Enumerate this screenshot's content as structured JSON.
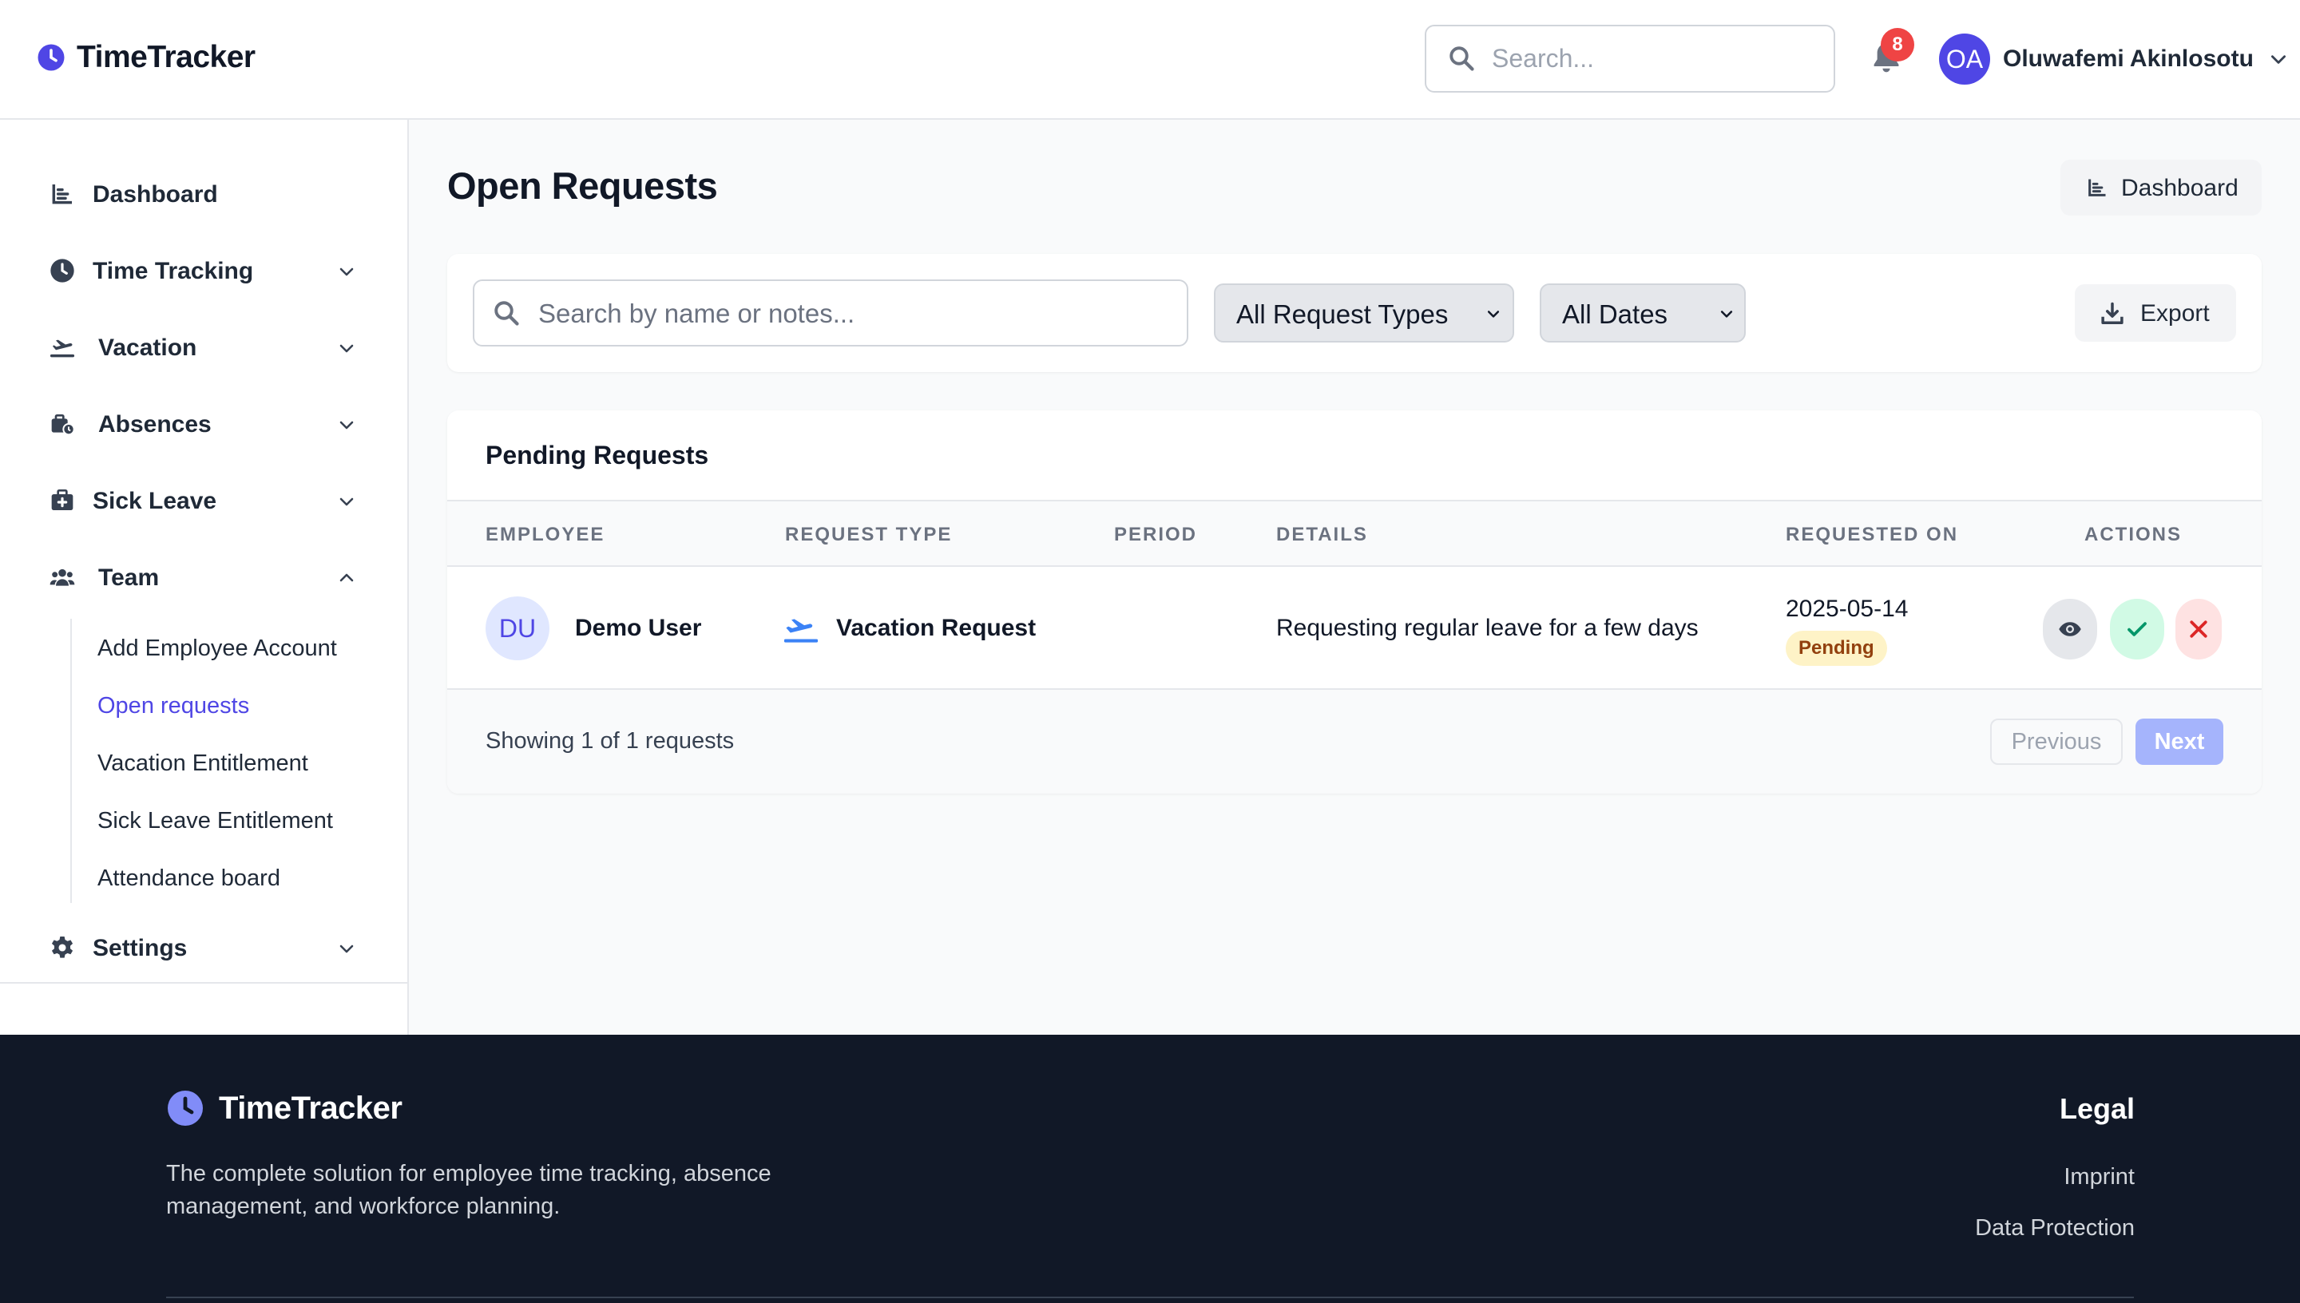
{
  "header": {
    "brand": "TimeTracker",
    "search_placeholder": "Search...",
    "notification_count": "8",
    "user_initials": "OA",
    "user_name": "Oluwafemi Akinlosotu"
  },
  "sidebar": {
    "items": [
      {
        "label": "Dashboard",
        "icon": "chart-icon"
      },
      {
        "label": "Time Tracking",
        "icon": "clock-icon",
        "expandable": true
      },
      {
        "label": "Vacation",
        "icon": "plane-icon",
        "expandable": true
      },
      {
        "label": "Absences",
        "icon": "absence-icon",
        "expandable": true
      },
      {
        "label": "Sick Leave",
        "icon": "medkit-icon",
        "expandable": true
      },
      {
        "label": "Team",
        "icon": "team-icon",
        "expanded": true
      },
      {
        "label": "Settings",
        "icon": "gear-icon",
        "expandable": true
      }
    ],
    "team_sub": [
      {
        "label": "Add Employee Account"
      },
      {
        "label": "Open requests",
        "active": true
      },
      {
        "label": "Vacation Entitlement"
      },
      {
        "label": "Sick Leave Entitlement"
      },
      {
        "label": "Attendance board"
      }
    ]
  },
  "main": {
    "title": "Open Requests",
    "dashboard_button": "Dashboard",
    "filters": {
      "search_placeholder": "Search by name or notes...",
      "request_type": "All Request Types",
      "dates": "All Dates",
      "export_button": "Export"
    },
    "table": {
      "title": "Pending Requests",
      "columns": [
        "EMPLOYEE",
        "REQUEST TYPE",
        "PERIOD",
        "DETAILS",
        "REQUESTED ON",
        "ACTIONS"
      ],
      "rows": [
        {
          "initials": "DU",
          "employee": "Demo User",
          "request_type": "Vacation Request",
          "period": "",
          "details": "Requesting regular leave for a few days",
          "requested_on": "2025-05-14",
          "status": "Pending"
        }
      ],
      "showing": "Showing 1 of 1 requests",
      "prev_label": "Previous",
      "next_label": "Next"
    }
  },
  "footer": {
    "brand": "TimeTracker",
    "tagline": "The complete solution for employee time tracking, absence management, and workforce planning.",
    "legal_title": "Legal",
    "links": [
      "Imprint",
      "Data Protection"
    ]
  },
  "colors": {
    "accent": "#4f46e5",
    "footer_bg": "#111827",
    "pending_bg": "#fef3c7",
    "approve_bg": "#d1fae5",
    "reject_bg": "#fee2e2"
  }
}
